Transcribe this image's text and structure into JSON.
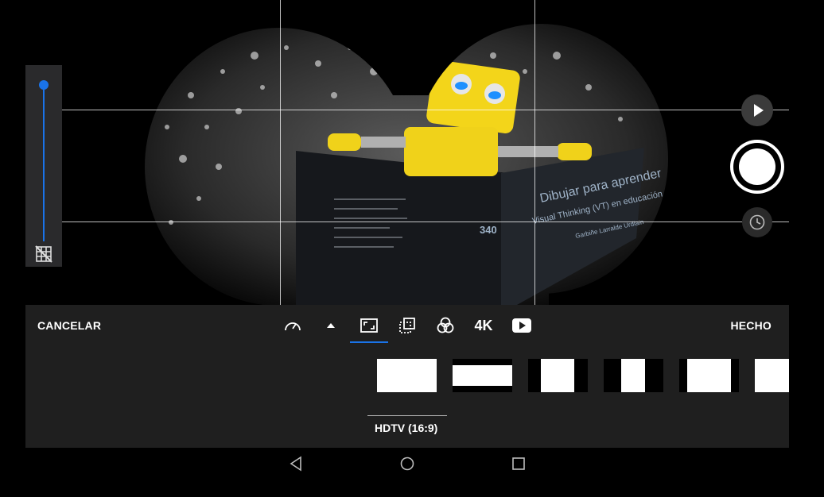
{
  "panel": {
    "cancel_label": "CANCELAR",
    "done_label": "HECHO",
    "selected_aspect_label": "HDTV (16:9)"
  },
  "toolbar": {
    "icons": [
      "speedometer-icon",
      "chevron-up-icon",
      "aspect-ratio-icon",
      "crop-rotate-icon",
      "filters-icon",
      "4k-icon",
      "youtube-icon"
    ],
    "quality_label": "4K",
    "active_index": 2
  },
  "zoom": {
    "level": 1.0
  },
  "colors": {
    "accent": "#1a73e8",
    "panel_bg": "#1f1f1f"
  }
}
